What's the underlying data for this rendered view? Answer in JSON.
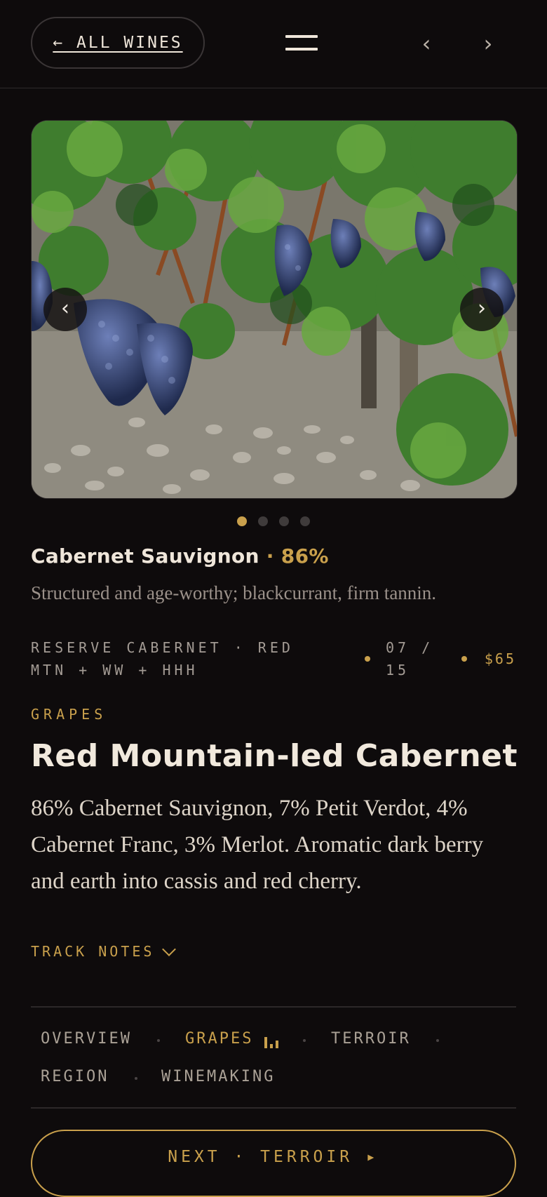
{
  "header": {
    "back_label": "← ALL WINES",
    "menu_icon": "menu-icon",
    "prev_glyph": "‹",
    "next_glyph": "›"
  },
  "carousel": {
    "prev_glyph": "‹",
    "next_glyph": "›",
    "slide_count": 4,
    "active_slide": 1
  },
  "grape": {
    "name": "Cabernet Sauvignon",
    "separator": " · ",
    "percent": "86%",
    "description": "Structured and age-worthy; blackcurrant, firm tannin."
  },
  "meta": {
    "wine": "RESERVE CABERNET · RED MTN + WW + HHH",
    "vintage": "07 / 15",
    "price": "$65"
  },
  "section": {
    "eyebrow": "GRAPES",
    "headline": "Red Mountain-led Cabernet",
    "body": "86% Cabernet Sauvignon, 7% Petit Verdot, 4% Cabernet Franc, 3% Merlot. Aromatic dark berry and earth into cassis and red cherry."
  },
  "track_notes": {
    "label": "TRACK NOTES"
  },
  "tabs": {
    "overview": "OVERVIEW",
    "grapes": "GRAPES",
    "terroir": "TERROIR",
    "region": "REGION",
    "winemaking": "WINEMAKING",
    "separator": "·"
  },
  "next": {
    "label": "NEXT · TERROIR ▸"
  },
  "colors": {
    "accent": "#c9a04c",
    "background": "#0e0b0c",
    "text": "#efe6da"
  }
}
